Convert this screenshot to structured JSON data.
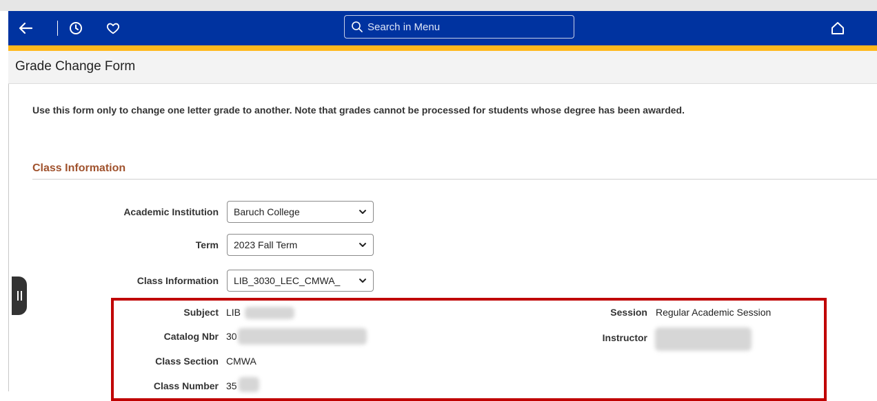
{
  "nav": {
    "back_icon": "arrow-left-icon",
    "history_icon": "clock-icon",
    "favorites_icon": "heart-icon",
    "home_icon": "home-icon",
    "search_placeholder": "Search in Menu",
    "bar_color": "#0033a0",
    "accent_color": "#ffb81c"
  },
  "page": {
    "title": "Grade Change Form",
    "instructions": "Use this form only to change one letter grade to another.  Note that grades cannot be processed for students whose degree has been awarded."
  },
  "class_info": {
    "section_title": "Class Information",
    "section_title_color": "#a0522d",
    "fields": {
      "institution_label": "Academic Institution",
      "institution_value": "Baruch College",
      "term_label": "Term",
      "term_value": "2023 Fall Term",
      "class_label": "Class Information",
      "class_value": "LIB_3030_LEC_CMWA_"
    },
    "details": {
      "subject_label": "Subject",
      "subject_value": "LIB",
      "catalog_label": "Catalog Nbr",
      "catalog_value": "30",
      "section_label": "Class Section",
      "section_value": "CMWA",
      "number_label": "Class Number",
      "number_value": "35",
      "session_label": "Session",
      "session_value": "Regular Academic Session",
      "instructor_label": "Instructor",
      "instructor_value": ""
    },
    "highlight_color": "#c00000"
  }
}
